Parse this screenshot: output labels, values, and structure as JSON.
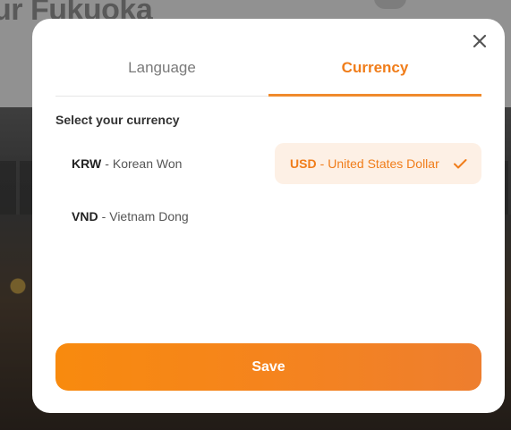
{
  "background": {
    "title": "ur Fukuoka"
  },
  "modal": {
    "tabs": [
      {
        "label": "Language",
        "active": false
      },
      {
        "label": "Currency",
        "active": true
      }
    ],
    "section_label": "Select your currency",
    "currencies": [
      {
        "code": "KRW",
        "separator": "-",
        "name": "Korean Won",
        "selected": false
      },
      {
        "code": "USD",
        "separator": "-",
        "name": "United States Dollar",
        "selected": true
      },
      {
        "code": "VND",
        "separator": "-",
        "name": "Vietnam Dong",
        "selected": false
      }
    ],
    "save_label": "Save",
    "icons": {
      "close": "close-icon",
      "selected": "check-icon"
    }
  },
  "colors": {
    "accent": "#f07d1a",
    "selected_bg": "#fdf0e5",
    "button_start": "#f88a0e",
    "button_end": "#ee7e2e"
  }
}
